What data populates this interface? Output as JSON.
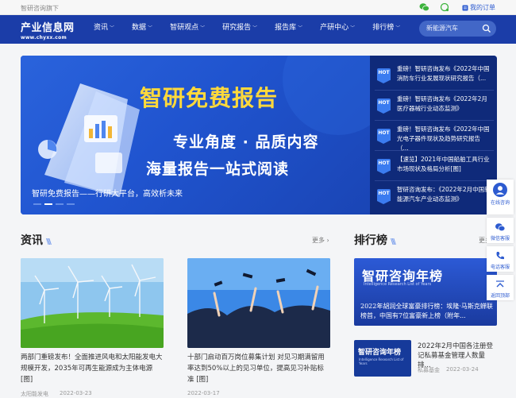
{
  "topbar": {
    "welcome": "智研咨询旗下",
    "orders": "我的订单"
  },
  "logo": {
    "cn": "产业信息网",
    "en": "www.chyxx.com"
  },
  "nav": {
    "items": [
      "资讯",
      "数据",
      "智研观点",
      "研究报告",
      "报告库",
      "产研中心",
      "排行榜"
    ],
    "search_placeholder": "新能源汽车"
  },
  "banner": {
    "headline": "智研免费报告",
    "line1": "专业角度 · 品质内容",
    "line2": "海量报告一站式阅读",
    "caption": "智研免费报告——行研大平台，高效析未来",
    "hot_badge": "HOT",
    "hot_items": [
      "重磅！智研咨询发布《2022年中国消防车行业发展现状研究报告（...",
      "重磅！智研咨询发布《2022年2月医疗器械行业动态监测》",
      "重磅！智研咨询发布《2022年中国光电子器件现状及趋势研究报告（...",
      "【速览】2021年中国船舶工具行业市场现状及格局分析[图]",
      "智研咨询发布：《2022年2月中国新能源汽车产业动态监测》"
    ]
  },
  "news": {
    "title": "资讯",
    "more": "更多",
    "cards": [
      {
        "title": "两部门重磅发布！全面推进风电和太阳能发电大规模开发，2035年可再生能源成为主体电源[图]",
        "source": "太阳能发电",
        "date": "2022-03-23"
      },
      {
        "title": "十部门启动百万岗位募集计划 对见习期满留用率达到50%以上的见习单位，提高见习补贴标准 [图]",
        "source": "",
        "date": "2022-03-17"
      }
    ]
  },
  "ranking": {
    "title": "排行榜",
    "more": "更多",
    "banner_title": "智研咨询年榜",
    "banner_sub": "Intelligence Research List of Years",
    "banner_text": "2022年胡润全球富豪排行榜：埃隆·马斯克蝉联榜首，中国有7位富豪新上榜（附年...",
    "item": {
      "thumb_title": "智研咨询年榜",
      "title": "2022年2月中国各注册登记私募基金管理人数量排...",
      "source": "私募基金",
      "date": "2022-03-24"
    }
  },
  "float_bar": {
    "online": "在线咨询",
    "wechat": "微信客服",
    "phone": "电话客服",
    "top": "返回顶部"
  },
  "colors": {
    "nav": "#1b3da8",
    "accent": "#2d5bd0",
    "banner_side": "#0f2a7a"
  }
}
